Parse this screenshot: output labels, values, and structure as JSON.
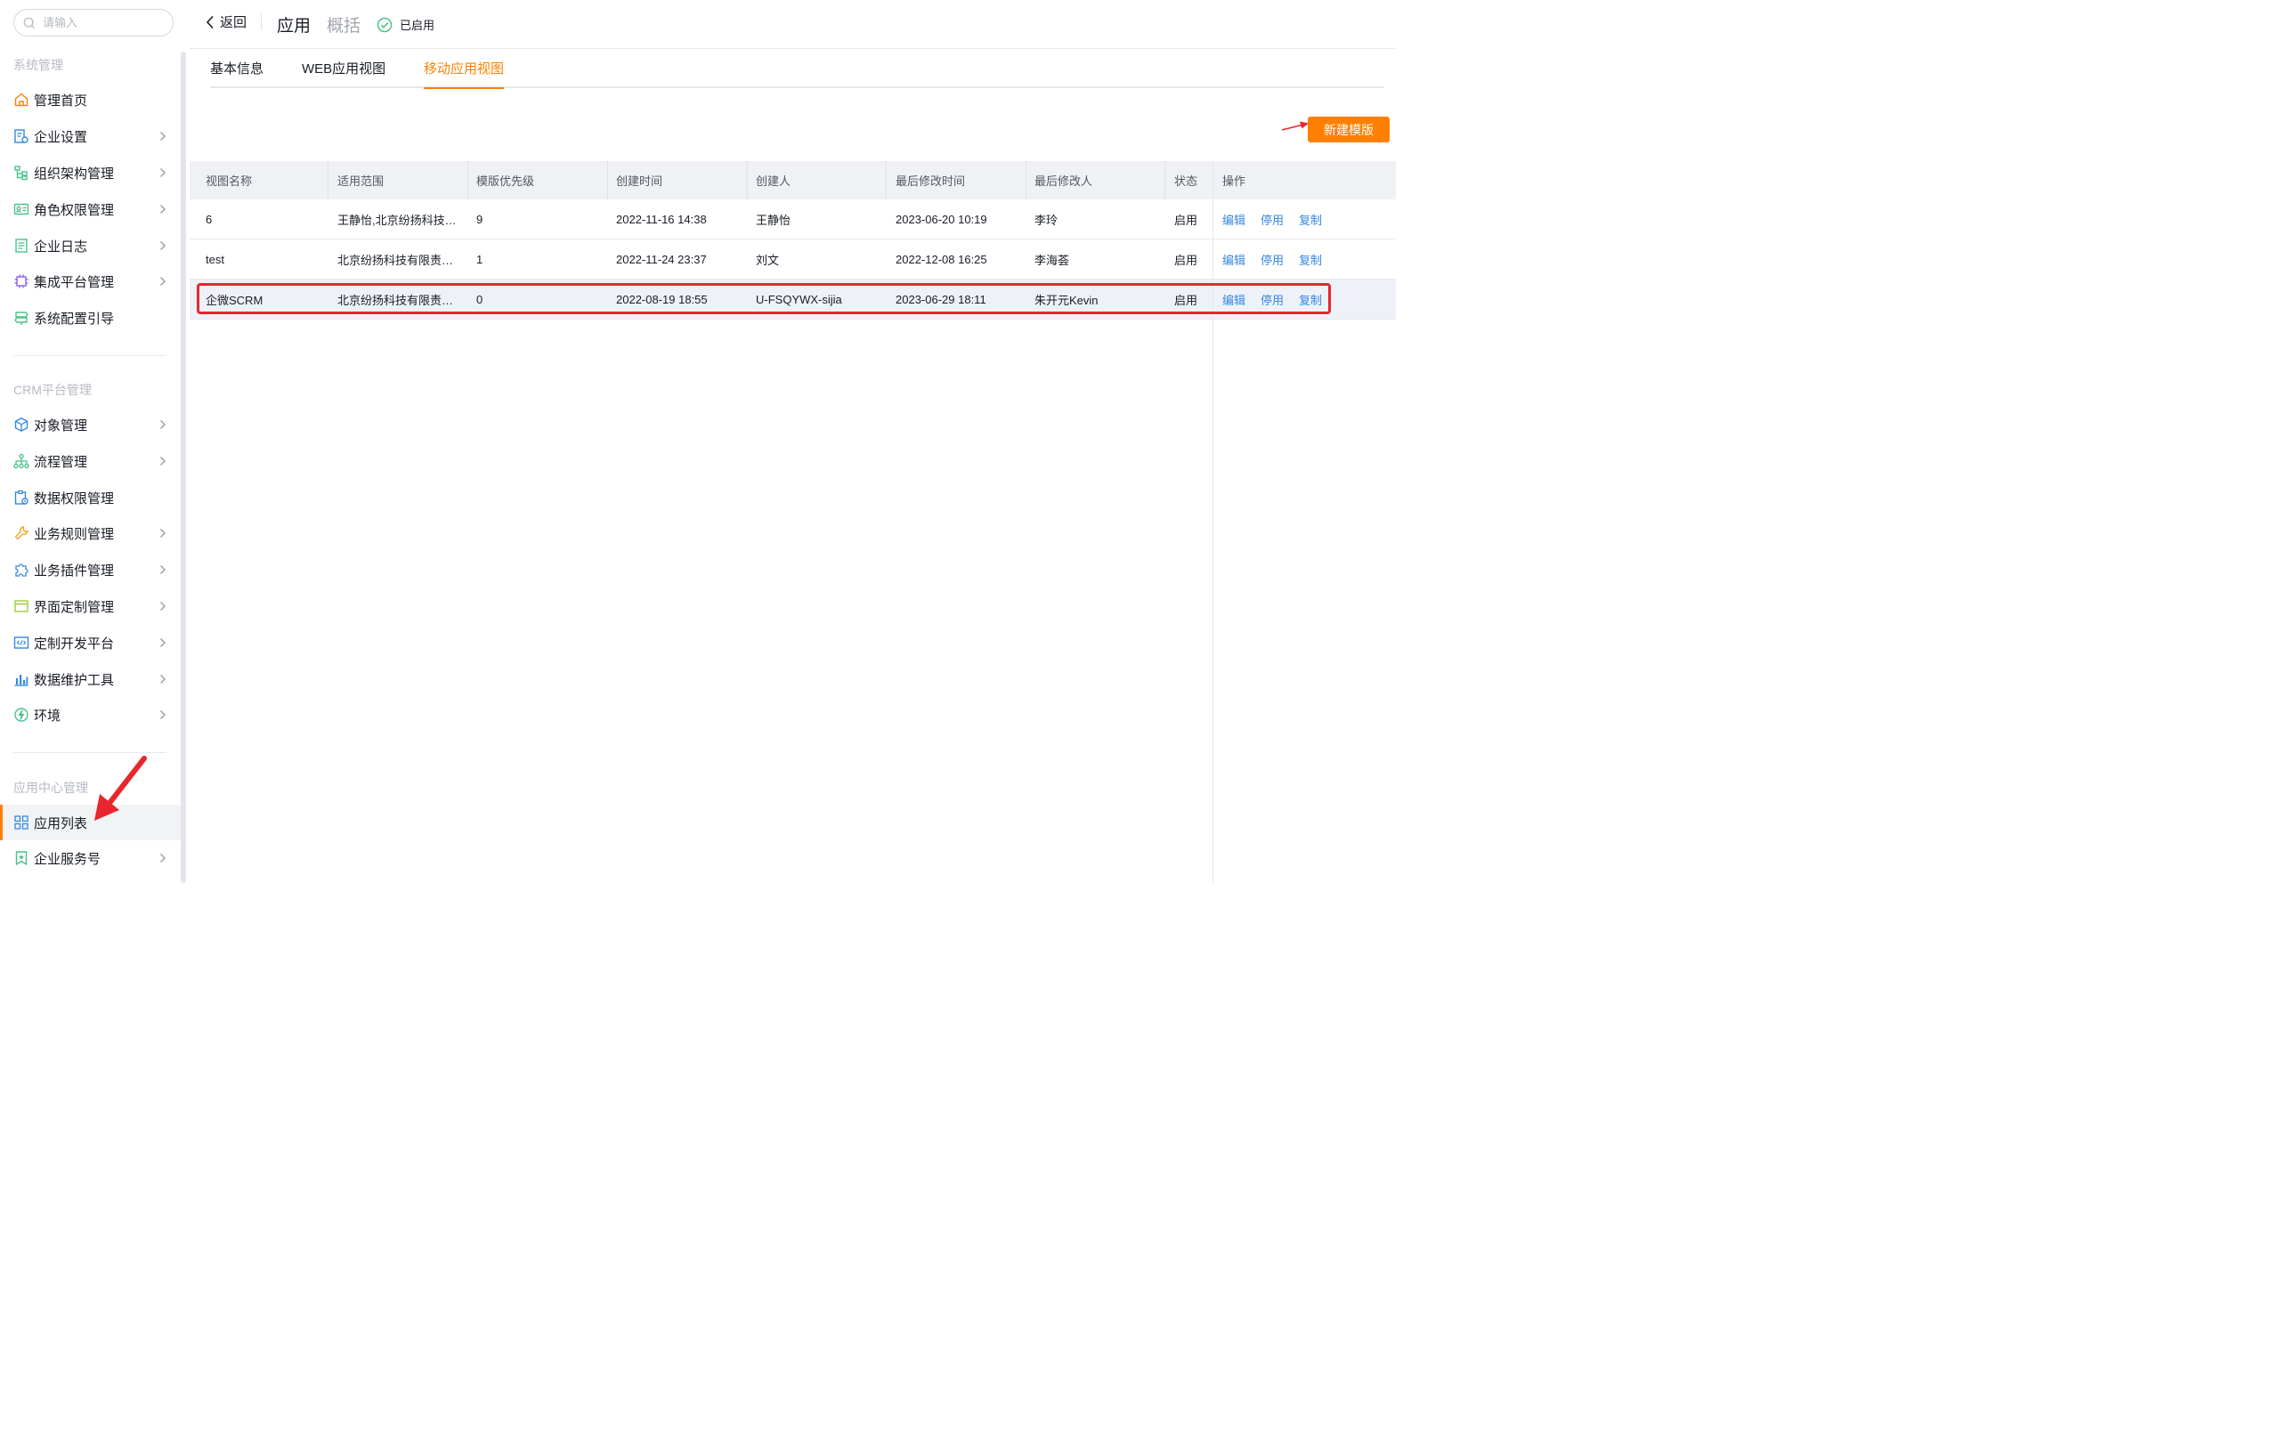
{
  "search": {
    "placeholder": "请输入"
  },
  "sidebar": {
    "sections": [
      {
        "title": "系统管理"
      },
      {
        "title": "CRM平台管理"
      },
      {
        "title": "应用中心管理"
      }
    ],
    "items": [
      {
        "label": "管理首页"
      },
      {
        "label": "企业设置"
      },
      {
        "label": "组织架构管理"
      },
      {
        "label": "角色权限管理"
      },
      {
        "label": "企业日志"
      },
      {
        "label": "集成平台管理"
      },
      {
        "label": "系统配置引导"
      },
      {
        "label": "对象管理"
      },
      {
        "label": "流程管理"
      },
      {
        "label": "数据权限管理"
      },
      {
        "label": "业务规则管理"
      },
      {
        "label": "业务插件管理"
      },
      {
        "label": "界面定制管理"
      },
      {
        "label": "定制开发平台"
      },
      {
        "label": "数据维护工具"
      },
      {
        "label": "环境"
      },
      {
        "label": "应用列表"
      },
      {
        "label": "企业服务号"
      }
    ]
  },
  "header": {
    "back": "返回",
    "title": "应用",
    "overview": "概括",
    "status": "已启用"
  },
  "tabs": [
    {
      "label": "基本信息"
    },
    {
      "label": "WEB应用视图"
    },
    {
      "label": "移动应用视图"
    }
  ],
  "toolbar": {
    "new_label": "新建模版"
  },
  "table": {
    "columns": [
      "视图名称",
      "适用范围",
      "模版优先级",
      "创建时间",
      "创建人",
      "最后修改时间",
      "最后修改人",
      "状态",
      "操作"
    ],
    "rows": [
      {
        "name": "6",
        "scope": "王静怡,北京纷扬科技…",
        "priority": "9",
        "created": "2022-11-16 14:38",
        "creator": "王静怡",
        "modified": "2023-06-20 10:19",
        "modifier": "李玲",
        "status": "启用"
      },
      {
        "name": "test",
        "scope": "北京纷扬科技有限责…",
        "priority": "1",
        "created": "2022-11-24 23:37",
        "creator": "刘文",
        "modified": "2022-12-08 16:25",
        "modifier": "李海荟",
        "status": "启用"
      },
      {
        "name": "企微SCRM",
        "scope": "北京纷扬科技有限责…",
        "priority": "0",
        "created": "2022-08-19 18:55",
        "creator": "U-FSQYWX-sijia",
        "modified": "2023-06-29 18:11",
        "modifier": "朱开元Kevin",
        "status": "启用"
      }
    ],
    "actions": {
      "edit": "编辑",
      "disable": "停用",
      "copy": "复制"
    }
  },
  "colors": {
    "accent": "#ff8000",
    "link": "#3487e2",
    "annotation": "#e8262e",
    "success": "#4cc28a"
  }
}
